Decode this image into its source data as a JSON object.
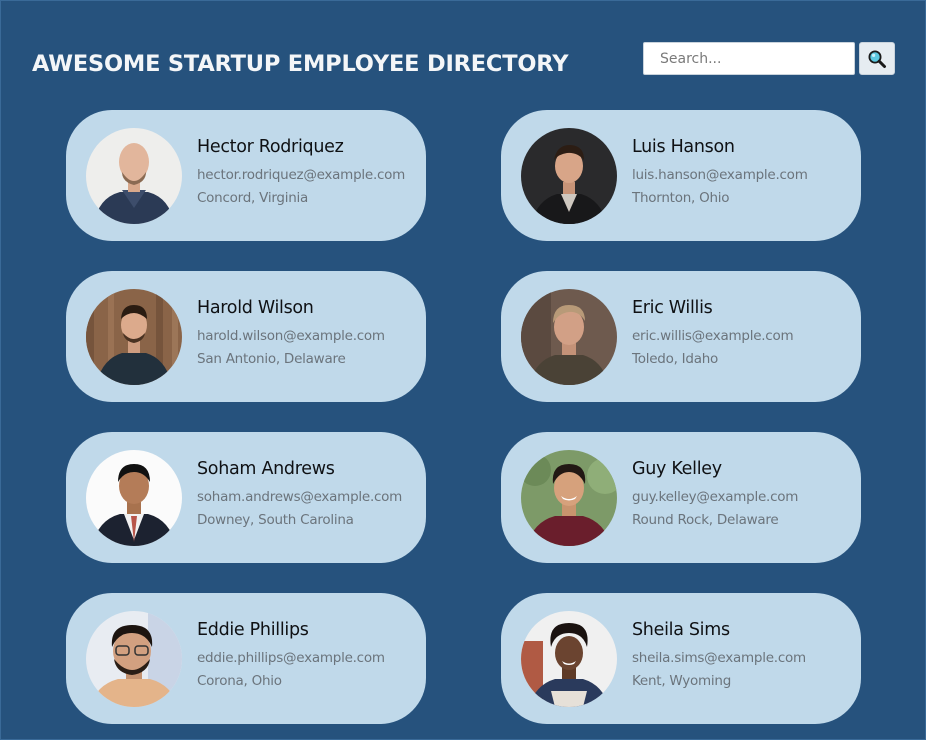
{
  "header": {
    "title": "AWESOME STARTUP EMPLOYEE DIRECTORY"
  },
  "search": {
    "placeholder": "Search...",
    "value": "",
    "button_icon": "magnifier-icon"
  },
  "colors": {
    "background": "#26527d",
    "card": "#c0d9ea",
    "title": "#f4f6f8",
    "name": "#0f1114",
    "detail": "#6b747c"
  },
  "employees": [
    {
      "name": "Hector Rodriquez",
      "email": "hector.rodriquez@example.com",
      "location": "Concord, Virginia"
    },
    {
      "name": "Luis Hanson",
      "email": "luis.hanson@example.com",
      "location": "Thornton, Ohio"
    },
    {
      "name": "Harold Wilson",
      "email": "harold.wilson@example.com",
      "location": "San Antonio, Delaware"
    },
    {
      "name": "Eric Willis",
      "email": "eric.willis@example.com",
      "location": "Toledo, Idaho"
    },
    {
      "name": "Soham Andrews",
      "email": "soham.andrews@example.com",
      "location": "Downey, South Carolina"
    },
    {
      "name": "Guy Kelley",
      "email": "guy.kelley@example.com",
      "location": "Round Rock, Delaware"
    },
    {
      "name": "Eddie Phillips",
      "email": "eddie.phillips@example.com",
      "location": "Corona, Ohio"
    },
    {
      "name": "Sheila Sims",
      "email": "sheila.sims@example.com",
      "location": "Kent, Wyoming"
    }
  ]
}
